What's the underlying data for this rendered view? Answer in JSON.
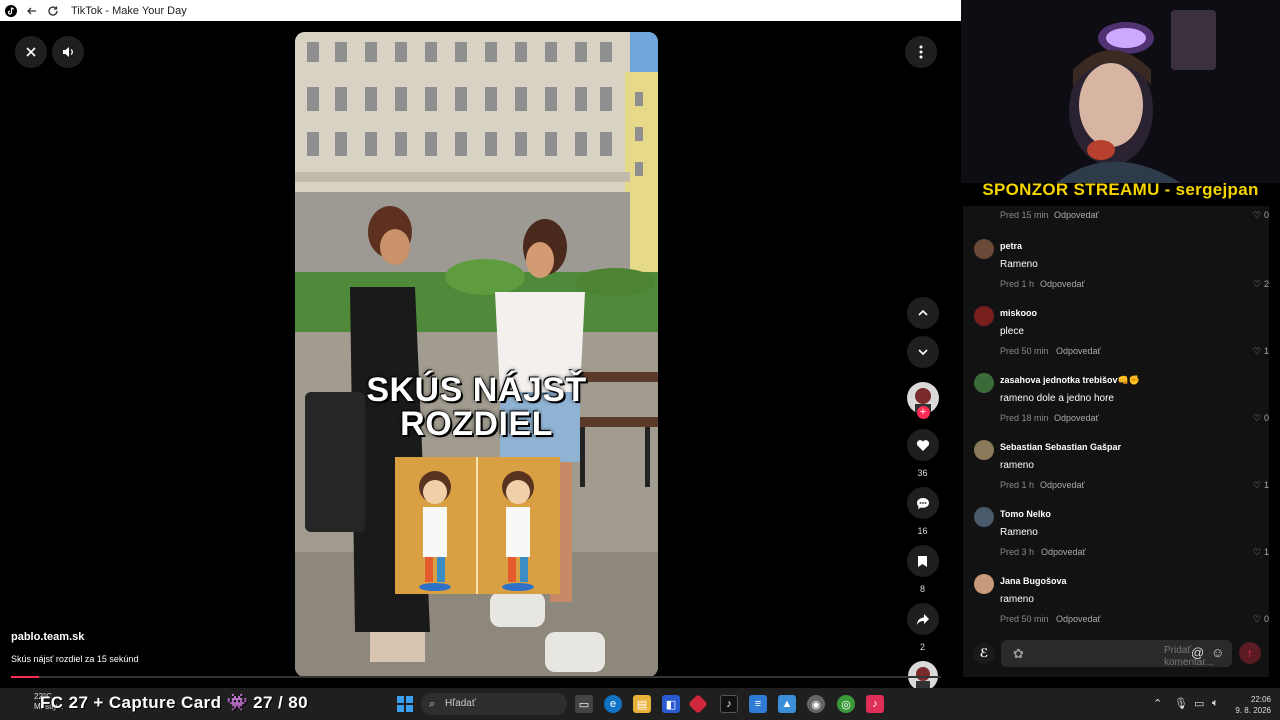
{
  "window": {
    "title": "TikTok - Make Your Day"
  },
  "video": {
    "overlay_line1": "SKÚS NÁJSŤ",
    "overlay_line2": "ROZDIEL",
    "author": "pablo.team.sk",
    "description": "Skús nájsť rozdiel za 15 sekúnd",
    "progress": 0.03
  },
  "actions": {
    "likes": "36",
    "comments": "16",
    "saves": "8",
    "shares": "2"
  },
  "stream": {
    "sponsor_text": "SPONZOR STREAMU - sergejpan"
  },
  "comments": {
    "top_partial": {
      "time": "Pred 15 min",
      "reply": "Odpovedať",
      "likes": "0"
    },
    "items": [
      {
        "user": "petra",
        "text": "Rameno",
        "time": "Pred 1 h",
        "reply": "Odpovedať",
        "likes": "2",
        "avatar_color": "#6b4a3a"
      },
      {
        "user": "miskooo",
        "text": "plece",
        "time": "Pred 50 min",
        "reply": "Odpovedať",
        "likes": "1",
        "avatar_color": "#7a1e1e"
      },
      {
        "user": "zasahova jednotka trebišov👊✊",
        "text": "rameno dole a jedno hore",
        "time": "Pred 18 min",
        "reply": "Odpovedať",
        "likes": "0",
        "avatar_color": "#3b6b3a"
      },
      {
        "user": "Sebastian Sebastian Gašpar",
        "text": "rameno",
        "time": "Pred 1 h",
        "reply": "Odpovedať",
        "likes": "1",
        "avatar_color": "#8a7a5a"
      },
      {
        "user": "Tomo Nelko",
        "text": "Rameno",
        "time": "Pred 3 h",
        "reply": "Odpovedať",
        "likes": "1",
        "avatar_color": "#4a5a6a"
      },
      {
        "user": "Jana Bugošova",
        "text": "rameno",
        "time": "Pred 50 min",
        "reply": "Odpovedať",
        "likes": "0",
        "avatar_color": "#c89a7a"
      }
    ],
    "input_placeholder": "Pridať komentár..."
  },
  "taskbar": {
    "weather_temp": "22°C",
    "weather_desc": "Mostly...",
    "overlay": "FC 27 + Capture Card 👾 27 / 80",
    "search_placeholder": "Hľadať",
    "time": "22:06",
    "date": "9. 8. 2026"
  },
  "colors": {
    "accent": "#fe2c55",
    "sponsor": "#f5d400"
  }
}
